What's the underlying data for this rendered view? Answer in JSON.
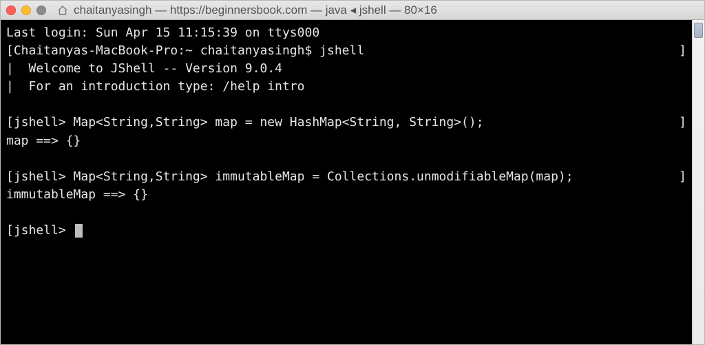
{
  "titlebar": {
    "title": "chaitanyasingh — https://beginnersbook.com — java ◂ jshell — 80×16"
  },
  "terminal": {
    "lines": [
      "Last login: Sun Apr 15 11:15:39 on ttys000",
      "[Chaitanyas-MacBook-Pro:~ chaitanyasingh$ jshell",
      "|  Welcome to JShell -- Version 9.0.4",
      "|  For an introduction type: /help intro",
      "",
      "[jshell> Map<String,String> map = new HashMap<String, String>();",
      "map ==> {}",
      "",
      "[jshell> Map<String,String> immutableMap = Collections.unmodifiableMap(map);",
      "immutableMap ==> {}",
      ""
    ],
    "prompt": "[jshell> "
  }
}
